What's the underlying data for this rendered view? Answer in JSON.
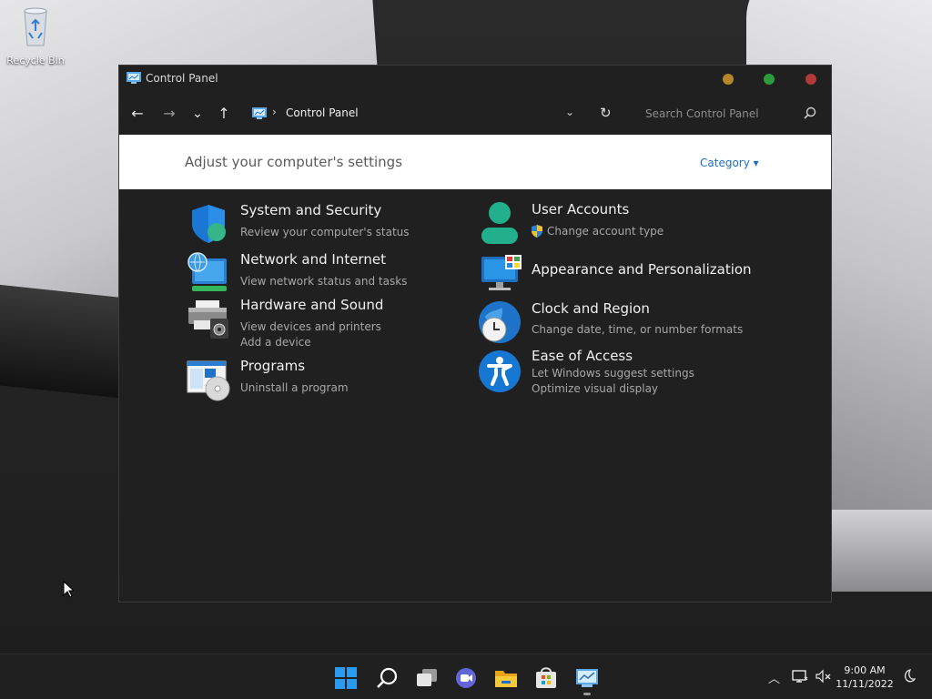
{
  "desktop": {
    "icons": [
      {
        "label": "Recycle Bin",
        "icon": "recycle-bin-icon"
      }
    ]
  },
  "window": {
    "title": "Control Panel",
    "controls": {
      "minimize_color": "#b4862c",
      "maximize_color": "#2e9a3e",
      "close_color": "#b33a3a"
    }
  },
  "navbar": {
    "back": "←",
    "forward": "→",
    "recent": "⌄",
    "up": "↑",
    "breadcrumb_sep": "›",
    "breadcrumb": "Control Panel",
    "address_dropdown": "⌄",
    "refresh": "↻",
    "search_placeholder": "Search Control Panel"
  },
  "heading": {
    "title": "Adjust your computer's settings",
    "view_by": "Category ▾"
  },
  "categories": [
    {
      "title": "System and Security",
      "icon": "shield-icon",
      "links": [
        "Review your computer's status"
      ]
    },
    {
      "title": "Network and Internet",
      "icon": "network-globe-icon",
      "links": [
        "View network status and tasks"
      ]
    },
    {
      "title": "Hardware and Sound",
      "icon": "printer-speaker-icon",
      "links": [
        "View devices and printers",
        "Add a device"
      ]
    },
    {
      "title": "Programs",
      "icon": "programs-disc-icon",
      "links": [
        "Uninstall a program"
      ]
    },
    {
      "title": "User Accounts",
      "icon": "user-icon",
      "links": [
        "Change account type"
      ]
    },
    {
      "title": "Appearance and Personalization",
      "icon": "monitor-palette-icon",
      "links": []
    },
    {
      "title": "Clock and Region",
      "icon": "globe-clock-icon",
      "links": [
        "Change date, time, or number formats"
      ]
    },
    {
      "title": "Ease of Access",
      "icon": "accessibility-icon",
      "links": [
        "Let Windows suggest settings",
        "Optimize visual display"
      ]
    }
  ],
  "taskbar": {
    "apps": [
      "start-icon",
      "search-icon",
      "task-view-icon",
      "chat-icon",
      "file-explorer-icon",
      "store-icon",
      "control-panel-icon"
    ],
    "tray": {
      "chevron": "︿"
    },
    "time": "9:00 AM",
    "date": "11/11/2022"
  },
  "colors": {
    "accent": "#1f6fc4",
    "window_bg": "#202020",
    "taskbar_bg": "#202020"
  }
}
